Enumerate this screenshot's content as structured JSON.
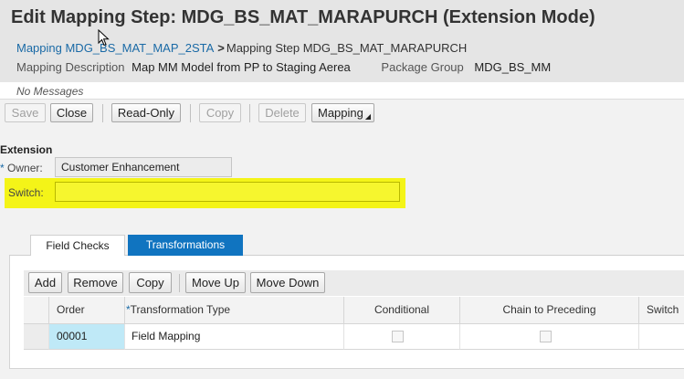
{
  "header": {
    "title": "Edit Mapping Step: MDG_BS_MAT_MARAPURCH (Extension Mode)",
    "breadcrumb": {
      "link": "Mapping MDG_BS_MAT_MAP_2STA",
      "separator": ">",
      "current": "Mapping Step MDG_BS_MAT_MARAPURCH"
    },
    "description_label": "Mapping Description",
    "description_value": "Map MM Model from PP to Staging Aerea",
    "package_label": "Package Group",
    "package_value": "MDG_BS_MM"
  },
  "messages": {
    "text": "No Messages"
  },
  "toolbar": {
    "save": "Save",
    "close": "Close",
    "read_only": "Read-Only",
    "copy": "Copy",
    "delete": "Delete",
    "mapping": "Mapping"
  },
  "extension": {
    "title": "Extension",
    "required_marker": "*",
    "owner_label": "Owner:",
    "owner_value": "Customer Enhancement",
    "switch_label": "Switch:",
    "switch_value": "",
    "highlight_color": "#f4f418"
  },
  "tabs": {
    "field_checks": "Field Checks",
    "transformations": "Transformations",
    "active": "Transformations",
    "active_color": "#1074c0"
  },
  "table_toolbar": {
    "add": "Add",
    "remove": "Remove",
    "copy": "Copy",
    "move_up": "Move Up",
    "move_down": "Move Down"
  },
  "table": {
    "columns": {
      "order": "Order",
      "required_marker": "*",
      "transformation_type": "Transformation Type",
      "conditional": "Conditional",
      "chain_to_preceding": "Chain to Preceding",
      "switch": "Switch"
    },
    "rows": [
      {
        "order": "00001",
        "transformation_type": "Field Mapping",
        "conditional": false,
        "chain_to_preceding": false,
        "switch": ""
      }
    ]
  }
}
